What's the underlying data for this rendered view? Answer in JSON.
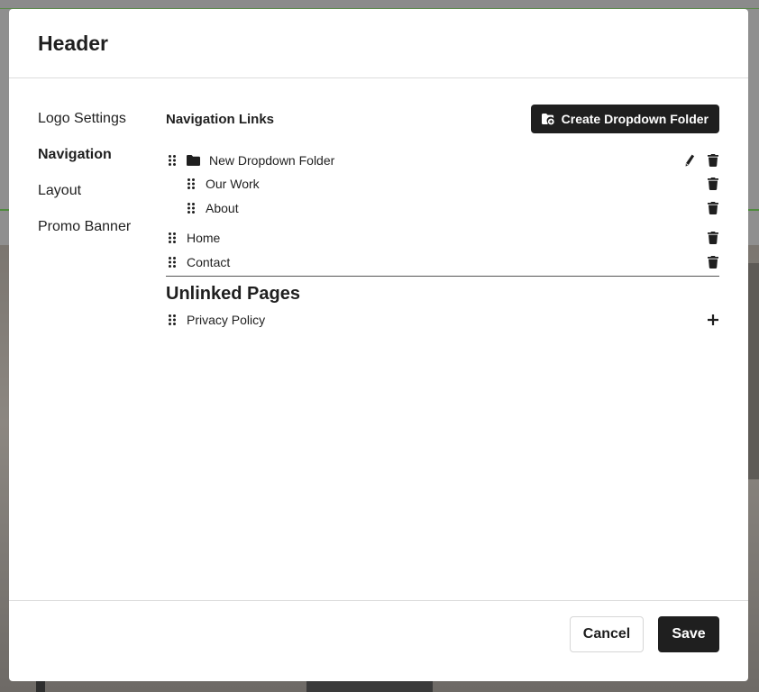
{
  "modal": {
    "title": "Header"
  },
  "sidebar": {
    "items": [
      {
        "label": "Logo Settings"
      },
      {
        "label": "Navigation"
      },
      {
        "label": "Layout"
      },
      {
        "label": "Promo Banner"
      }
    ],
    "active": "Navigation"
  },
  "navigation": {
    "title": "Navigation Links",
    "create_button": "Create Dropdown Folder",
    "folder": {
      "label": "New Dropdown Folder",
      "children": [
        {
          "label": "Our Work"
        },
        {
          "label": "About"
        }
      ]
    },
    "links": [
      {
        "label": "Home"
      },
      {
        "label": "Contact"
      }
    ]
  },
  "unlinked": {
    "title": "Unlinked Pages",
    "pages": [
      {
        "label": "Privacy Policy"
      }
    ]
  },
  "footer": {
    "cancel": "Cancel",
    "save": "Save"
  },
  "colors": {
    "primary": "#1f1f1f",
    "backdrop": "#8f8f8f",
    "border": "#dcdcdc"
  }
}
